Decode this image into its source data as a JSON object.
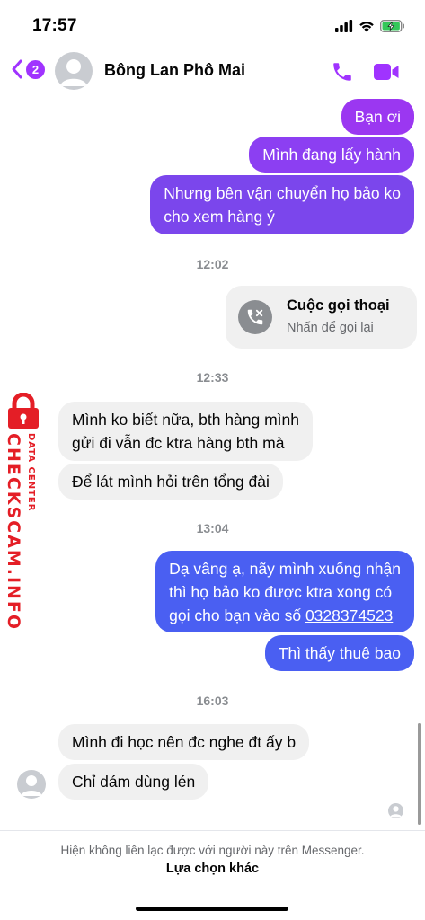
{
  "status_bar": {
    "time": "17:57",
    "signal_icon": "signal-icon",
    "wifi_icon": "wifi-icon",
    "battery_icon": "battery-charging-icon"
  },
  "header": {
    "back_badge": "2",
    "contact_name": "Bông Lan Phô Mai",
    "accent_color": "#a033ff"
  },
  "messages": {
    "out1": "Bạn ơi",
    "out2": "Mình đang lấy hành",
    "out3_line1": "Nhưng bên vận chuyển họ bảo ko",
    "out3_line2": "cho xem hàng ý",
    "time1": "12:02",
    "call_title": "Cuộc gọi thoại",
    "call_sub": "Nhấn để gọi lại",
    "time2": "12:33",
    "in1_line1": "Mình ko biết nữa, bth hàng mình",
    "in1_line2": "gửi đi vẫn đc ktra hàng bth mà",
    "in2": "Để lát mình hỏi trên tổng đài",
    "time3": "13:04",
    "out4_line1": "Dạ vâng ạ, nãy mình xuống nhận",
    "out4_line2": "thì họ bảo ko được ktra xong có",
    "out4_line3_prefix": "gọi cho bạn vào số ",
    "out4_phone": "0328374523",
    "out5": "Thì thấy thuê bao",
    "time4": "16:03",
    "in3": "Mình đi học nên đc nghe đt ấy b",
    "in4": "Chỉ dám dùng lén"
  },
  "watermark": {
    "main": "CHECKSCAM.INFO",
    "sub": "DATA CENTER",
    "color": "#e41e26"
  },
  "footer": {
    "note": "Hiện không liên lạc được với người này trên Messenger.",
    "link": "Lựa chọn khác"
  },
  "colors": {
    "bubble_purple": "#9b37f1",
    "bubble_violet": "#7b46ec",
    "bubble_blue": "#4a5ff2",
    "bubble_gray": "#f0f0f0"
  }
}
